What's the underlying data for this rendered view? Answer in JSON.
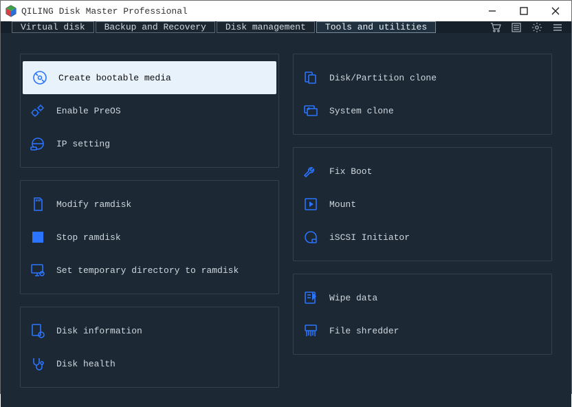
{
  "title": "QILING Disk Master Professional",
  "tabs": [
    {
      "label": "Virtual disk"
    },
    {
      "label": "Backup and Recovery"
    },
    {
      "label": "Disk management"
    },
    {
      "label": "Tools and utilities",
      "active": true
    }
  ],
  "left_groups": [
    {
      "items": [
        {
          "icon": "disc-icon",
          "label": "Create bootable media",
          "selected": true
        },
        {
          "icon": "gears-icon",
          "label": "Enable PreOS"
        },
        {
          "icon": "netdisk-icon",
          "label": "IP setting"
        }
      ]
    },
    {
      "items": [
        {
          "icon": "sdcard-icon",
          "label": "Modify ramdisk"
        },
        {
          "icon": "square-stop-icon",
          "label": "Stop ramdisk"
        },
        {
          "icon": "monitor-gear-icon",
          "label": "Set temporary directory to ramdisk"
        }
      ]
    },
    {
      "items": [
        {
          "icon": "doc-disk-icon",
          "label": "Disk information"
        },
        {
          "icon": "steth-icon",
          "label": "Disk health"
        }
      ]
    }
  ],
  "right_groups": [
    {
      "items": [
        {
          "icon": "clone-icon",
          "label": "Disk/Partition clone"
        },
        {
          "icon": "sysclone-icon",
          "label": "System clone"
        }
      ]
    },
    {
      "items": [
        {
          "icon": "wrench-icon",
          "label": "Fix Boot"
        },
        {
          "icon": "play-sq-icon",
          "label": "Mount"
        },
        {
          "icon": "iscsi-icon",
          "label": "iSCSI Initiator"
        }
      ]
    },
    {
      "items": [
        {
          "icon": "wipe-icon",
          "label": "Wipe data"
        },
        {
          "icon": "shredder-icon",
          "label": "File shredder"
        }
      ]
    }
  ]
}
